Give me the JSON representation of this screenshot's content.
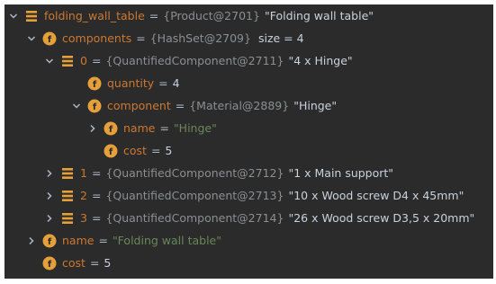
{
  "rows": [
    {
      "name": "folding_wall_table",
      "eq": "=",
      "ref": "{Product@2701}",
      "value": "\"Folding wall table\""
    },
    {
      "name": "components",
      "eq": "=",
      "ref": "{HashSet@2709}",
      "value": "size = 4"
    },
    {
      "name": "0",
      "eq": "=",
      "ref": "{QuantifiedComponent@2711}",
      "value": "\"4 x Hinge\""
    },
    {
      "name": "quantity",
      "eq": "=",
      "value": "4"
    },
    {
      "name": "component",
      "eq": "=",
      "ref": "{Material@2889}",
      "value": "\"Hinge\""
    },
    {
      "name": "name",
      "eq": "=",
      "value": "\"Hinge\""
    },
    {
      "name": "cost",
      "eq": "=",
      "value": "5"
    },
    {
      "name": "1",
      "eq": "=",
      "ref": "{QuantifiedComponent@2712}",
      "value": "\"1 x Main support\""
    },
    {
      "name": "2",
      "eq": "=",
      "ref": "{QuantifiedComponent@2713}",
      "value": "\"10 x Wood screw D4 x 45mm\""
    },
    {
      "name": "3",
      "eq": "=",
      "ref": "{QuantifiedComponent@2714}",
      "value": "\"26 x Wood screw D3,5 x 20mm\""
    },
    {
      "name": "name",
      "eq": "=",
      "value": "\"Folding wall table\""
    },
    {
      "name": "cost",
      "eq": "=",
      "value": "5"
    }
  ],
  "icons": {
    "field": "field-icon-orange-f",
    "object": "object-list-icon-orange"
  },
  "colors": {
    "background": "#2b2b2b",
    "variable_name": "#cc7832",
    "reference": "#8a8f94",
    "string": "#6a8759",
    "text": "#a9b7c6",
    "icon_orange": "#e5a03a"
  }
}
